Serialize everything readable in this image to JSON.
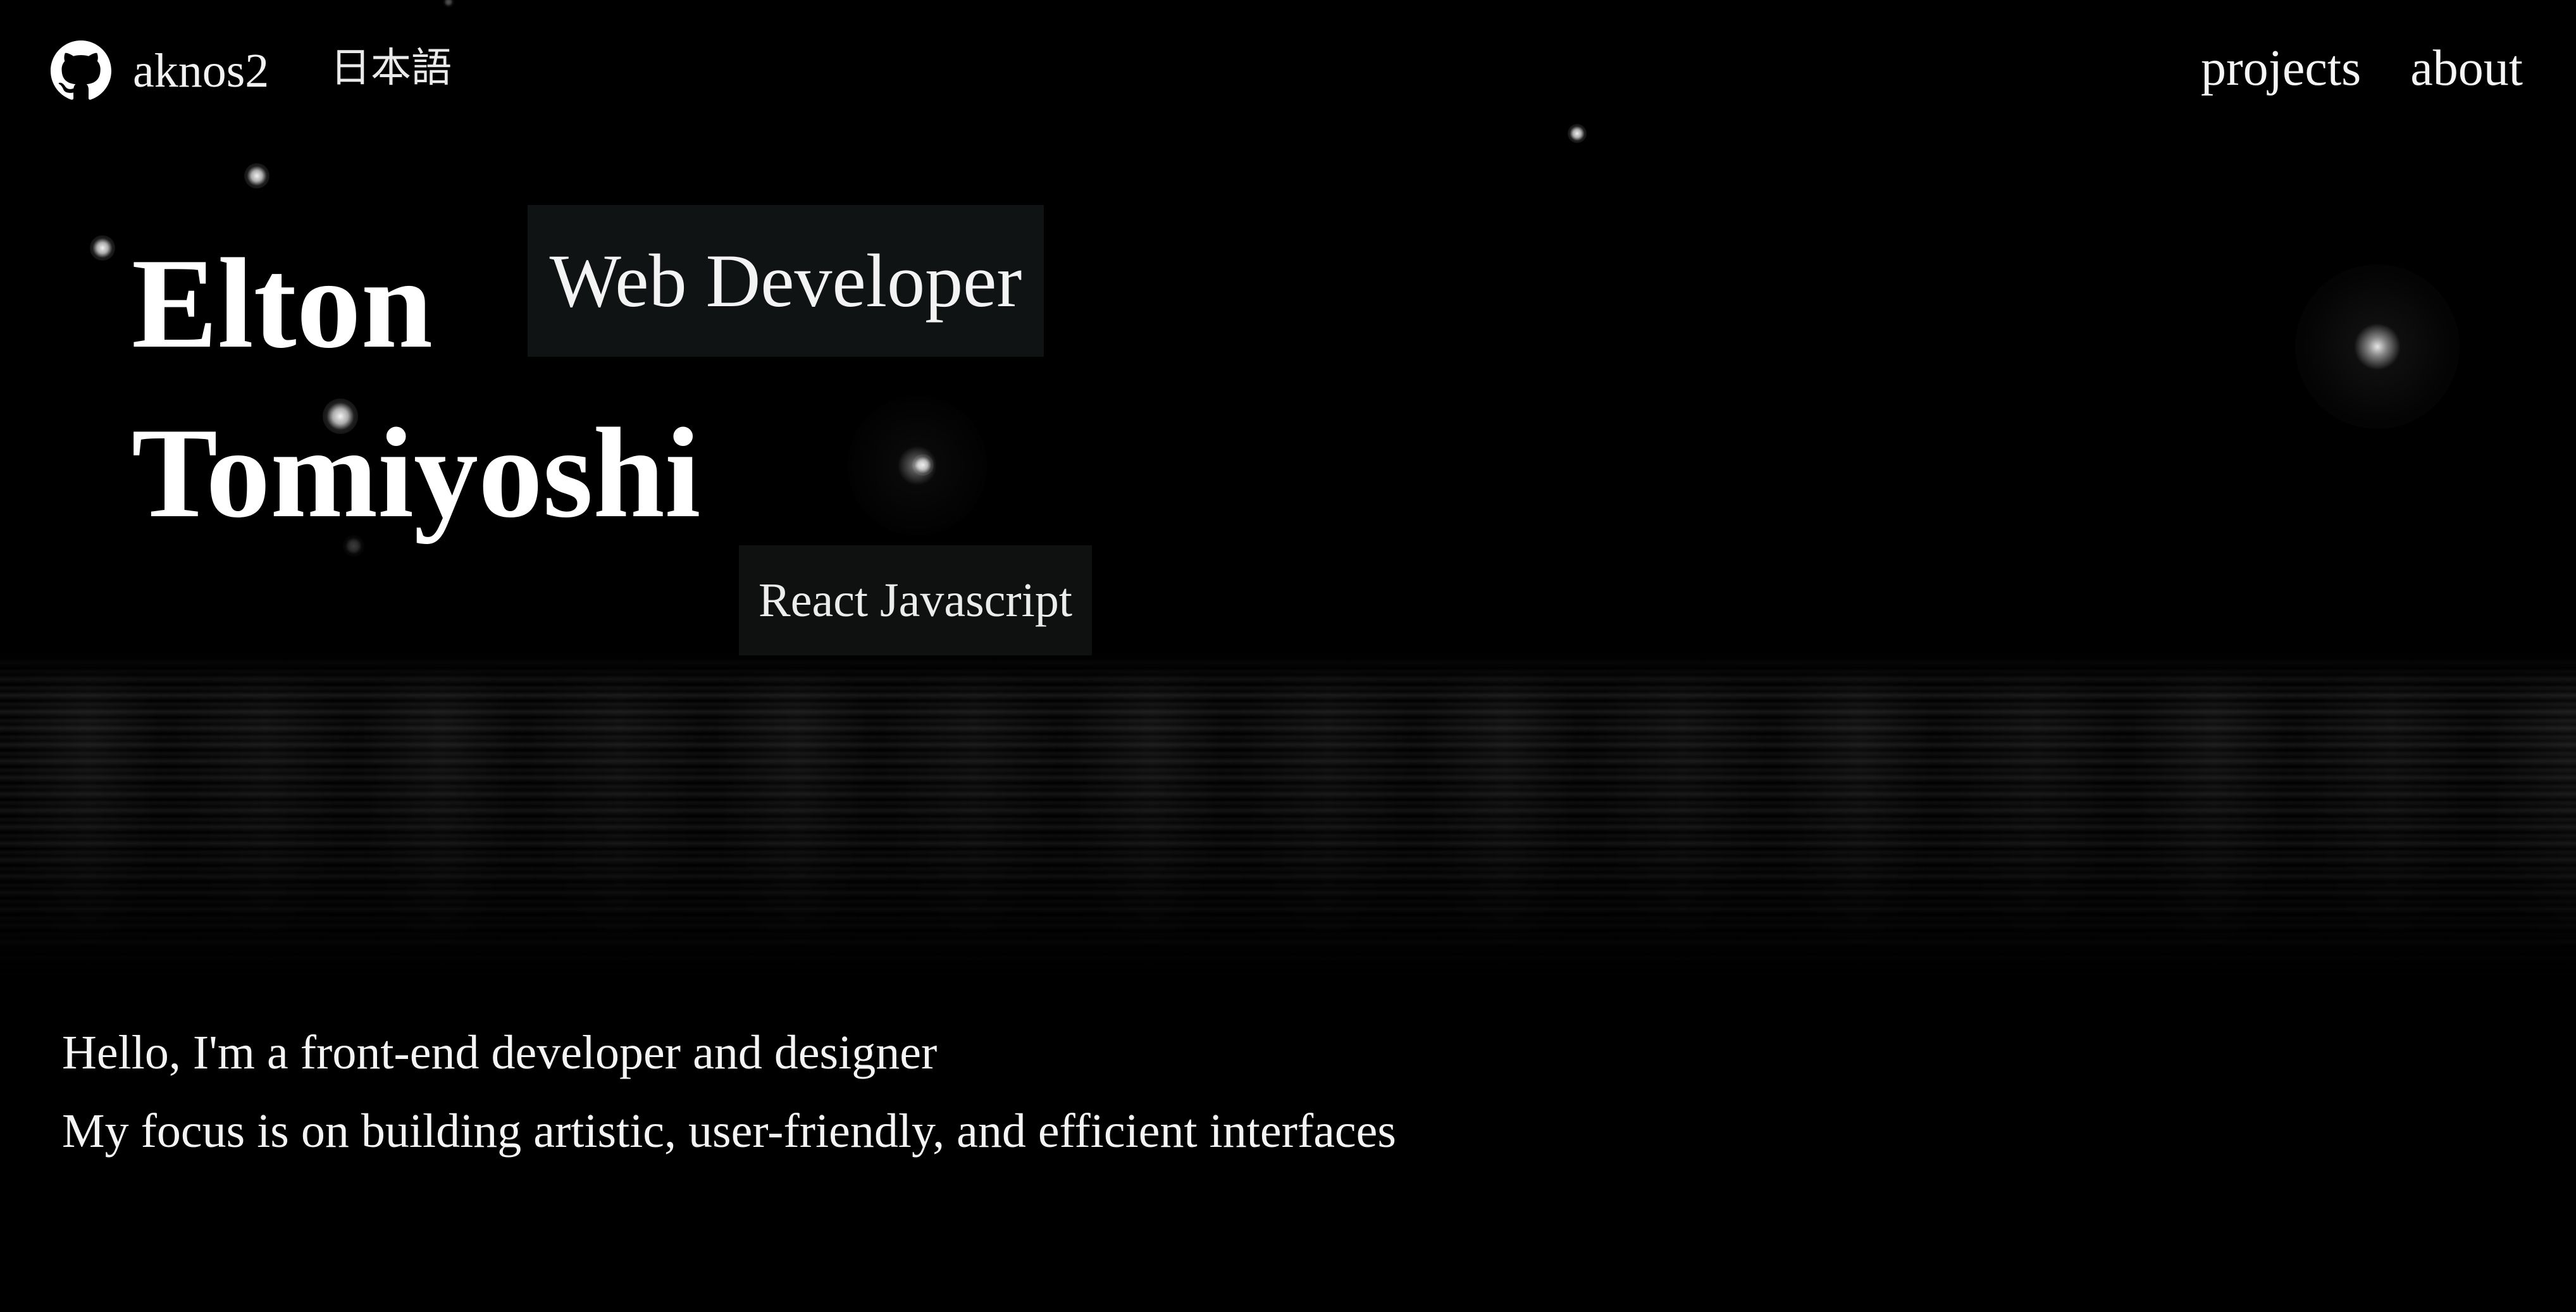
{
  "header": {
    "github_label": "aknos2",
    "language_label": "日本語",
    "nav": {
      "projects": "projects",
      "about": "about"
    }
  },
  "hero": {
    "first_name": "Elton",
    "last_name": "Tomiyoshi",
    "role_tag": "Web Developer",
    "tech_tag": "React Javascript"
  },
  "intro": {
    "line1": "Hello, I'm a front-end developer and designer",
    "line2": "My focus is on building artistic, user-friendly, and efficient interfaces"
  },
  "colors": {
    "background": "#000000",
    "text": "#ffffff",
    "tag_background": "#1e2222"
  },
  "icons": {
    "github": "github-icon"
  }
}
